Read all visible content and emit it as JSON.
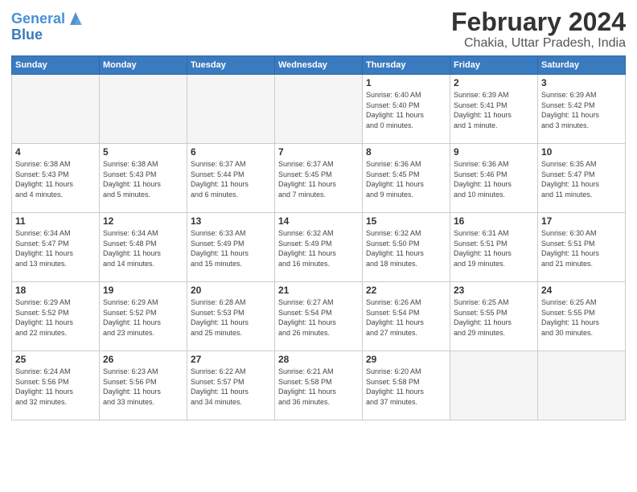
{
  "header": {
    "logo_line1": "General",
    "logo_line2": "Blue",
    "month_year": "February 2024",
    "location": "Chakia, Uttar Pradesh, India"
  },
  "weekdays": [
    "Sunday",
    "Monday",
    "Tuesday",
    "Wednesday",
    "Thursday",
    "Friday",
    "Saturday"
  ],
  "weeks": [
    [
      {
        "day": "",
        "info": ""
      },
      {
        "day": "",
        "info": ""
      },
      {
        "day": "",
        "info": ""
      },
      {
        "day": "",
        "info": ""
      },
      {
        "day": "1",
        "info": "Sunrise: 6:40 AM\nSunset: 5:40 PM\nDaylight: 11 hours\nand 0 minutes."
      },
      {
        "day": "2",
        "info": "Sunrise: 6:39 AM\nSunset: 5:41 PM\nDaylight: 11 hours\nand 1 minute."
      },
      {
        "day": "3",
        "info": "Sunrise: 6:39 AM\nSunset: 5:42 PM\nDaylight: 11 hours\nand 3 minutes."
      }
    ],
    [
      {
        "day": "4",
        "info": "Sunrise: 6:38 AM\nSunset: 5:43 PM\nDaylight: 11 hours\nand 4 minutes."
      },
      {
        "day": "5",
        "info": "Sunrise: 6:38 AM\nSunset: 5:43 PM\nDaylight: 11 hours\nand 5 minutes."
      },
      {
        "day": "6",
        "info": "Sunrise: 6:37 AM\nSunset: 5:44 PM\nDaylight: 11 hours\nand 6 minutes."
      },
      {
        "day": "7",
        "info": "Sunrise: 6:37 AM\nSunset: 5:45 PM\nDaylight: 11 hours\nand 7 minutes."
      },
      {
        "day": "8",
        "info": "Sunrise: 6:36 AM\nSunset: 5:45 PM\nDaylight: 11 hours\nand 9 minutes."
      },
      {
        "day": "9",
        "info": "Sunrise: 6:36 AM\nSunset: 5:46 PM\nDaylight: 11 hours\nand 10 minutes."
      },
      {
        "day": "10",
        "info": "Sunrise: 6:35 AM\nSunset: 5:47 PM\nDaylight: 11 hours\nand 11 minutes."
      }
    ],
    [
      {
        "day": "11",
        "info": "Sunrise: 6:34 AM\nSunset: 5:47 PM\nDaylight: 11 hours\nand 13 minutes."
      },
      {
        "day": "12",
        "info": "Sunrise: 6:34 AM\nSunset: 5:48 PM\nDaylight: 11 hours\nand 14 minutes."
      },
      {
        "day": "13",
        "info": "Sunrise: 6:33 AM\nSunset: 5:49 PM\nDaylight: 11 hours\nand 15 minutes."
      },
      {
        "day": "14",
        "info": "Sunrise: 6:32 AM\nSunset: 5:49 PM\nDaylight: 11 hours\nand 16 minutes."
      },
      {
        "day": "15",
        "info": "Sunrise: 6:32 AM\nSunset: 5:50 PM\nDaylight: 11 hours\nand 18 minutes."
      },
      {
        "day": "16",
        "info": "Sunrise: 6:31 AM\nSunset: 5:51 PM\nDaylight: 11 hours\nand 19 minutes."
      },
      {
        "day": "17",
        "info": "Sunrise: 6:30 AM\nSunset: 5:51 PM\nDaylight: 11 hours\nand 21 minutes."
      }
    ],
    [
      {
        "day": "18",
        "info": "Sunrise: 6:29 AM\nSunset: 5:52 PM\nDaylight: 11 hours\nand 22 minutes."
      },
      {
        "day": "19",
        "info": "Sunrise: 6:29 AM\nSunset: 5:52 PM\nDaylight: 11 hours\nand 23 minutes."
      },
      {
        "day": "20",
        "info": "Sunrise: 6:28 AM\nSunset: 5:53 PM\nDaylight: 11 hours\nand 25 minutes."
      },
      {
        "day": "21",
        "info": "Sunrise: 6:27 AM\nSunset: 5:54 PM\nDaylight: 11 hours\nand 26 minutes."
      },
      {
        "day": "22",
        "info": "Sunrise: 6:26 AM\nSunset: 5:54 PM\nDaylight: 11 hours\nand 27 minutes."
      },
      {
        "day": "23",
        "info": "Sunrise: 6:25 AM\nSunset: 5:55 PM\nDaylight: 11 hours\nand 29 minutes."
      },
      {
        "day": "24",
        "info": "Sunrise: 6:25 AM\nSunset: 5:55 PM\nDaylight: 11 hours\nand 30 minutes."
      }
    ],
    [
      {
        "day": "25",
        "info": "Sunrise: 6:24 AM\nSunset: 5:56 PM\nDaylight: 11 hours\nand 32 minutes."
      },
      {
        "day": "26",
        "info": "Sunrise: 6:23 AM\nSunset: 5:56 PM\nDaylight: 11 hours\nand 33 minutes."
      },
      {
        "day": "27",
        "info": "Sunrise: 6:22 AM\nSunset: 5:57 PM\nDaylight: 11 hours\nand 34 minutes."
      },
      {
        "day": "28",
        "info": "Sunrise: 6:21 AM\nSunset: 5:58 PM\nDaylight: 11 hours\nand 36 minutes."
      },
      {
        "day": "29",
        "info": "Sunrise: 6:20 AM\nSunset: 5:58 PM\nDaylight: 11 hours\nand 37 minutes."
      },
      {
        "day": "",
        "info": ""
      },
      {
        "day": "",
        "info": ""
      }
    ]
  ]
}
